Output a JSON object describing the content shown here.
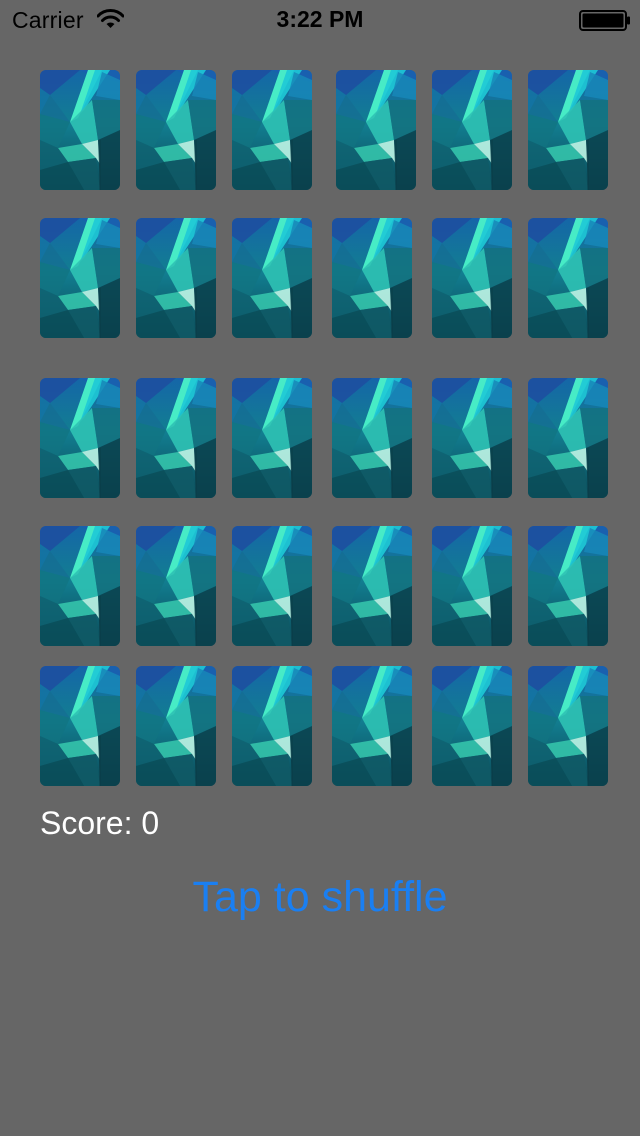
{
  "status_bar": {
    "carrier": "Carrier",
    "time": "3:22 PM",
    "wifi_icon": "wifi-icon",
    "battery_icon": "battery-full-icon"
  },
  "game": {
    "score_text": "Score: 0",
    "shuffle_label": "Tap to shuffle",
    "card_face": "face-down",
    "rows": 5,
    "cols": 6
  },
  "colors": {
    "background": "#666666",
    "accent": "#1a7ff2",
    "text": "#ffffff"
  }
}
